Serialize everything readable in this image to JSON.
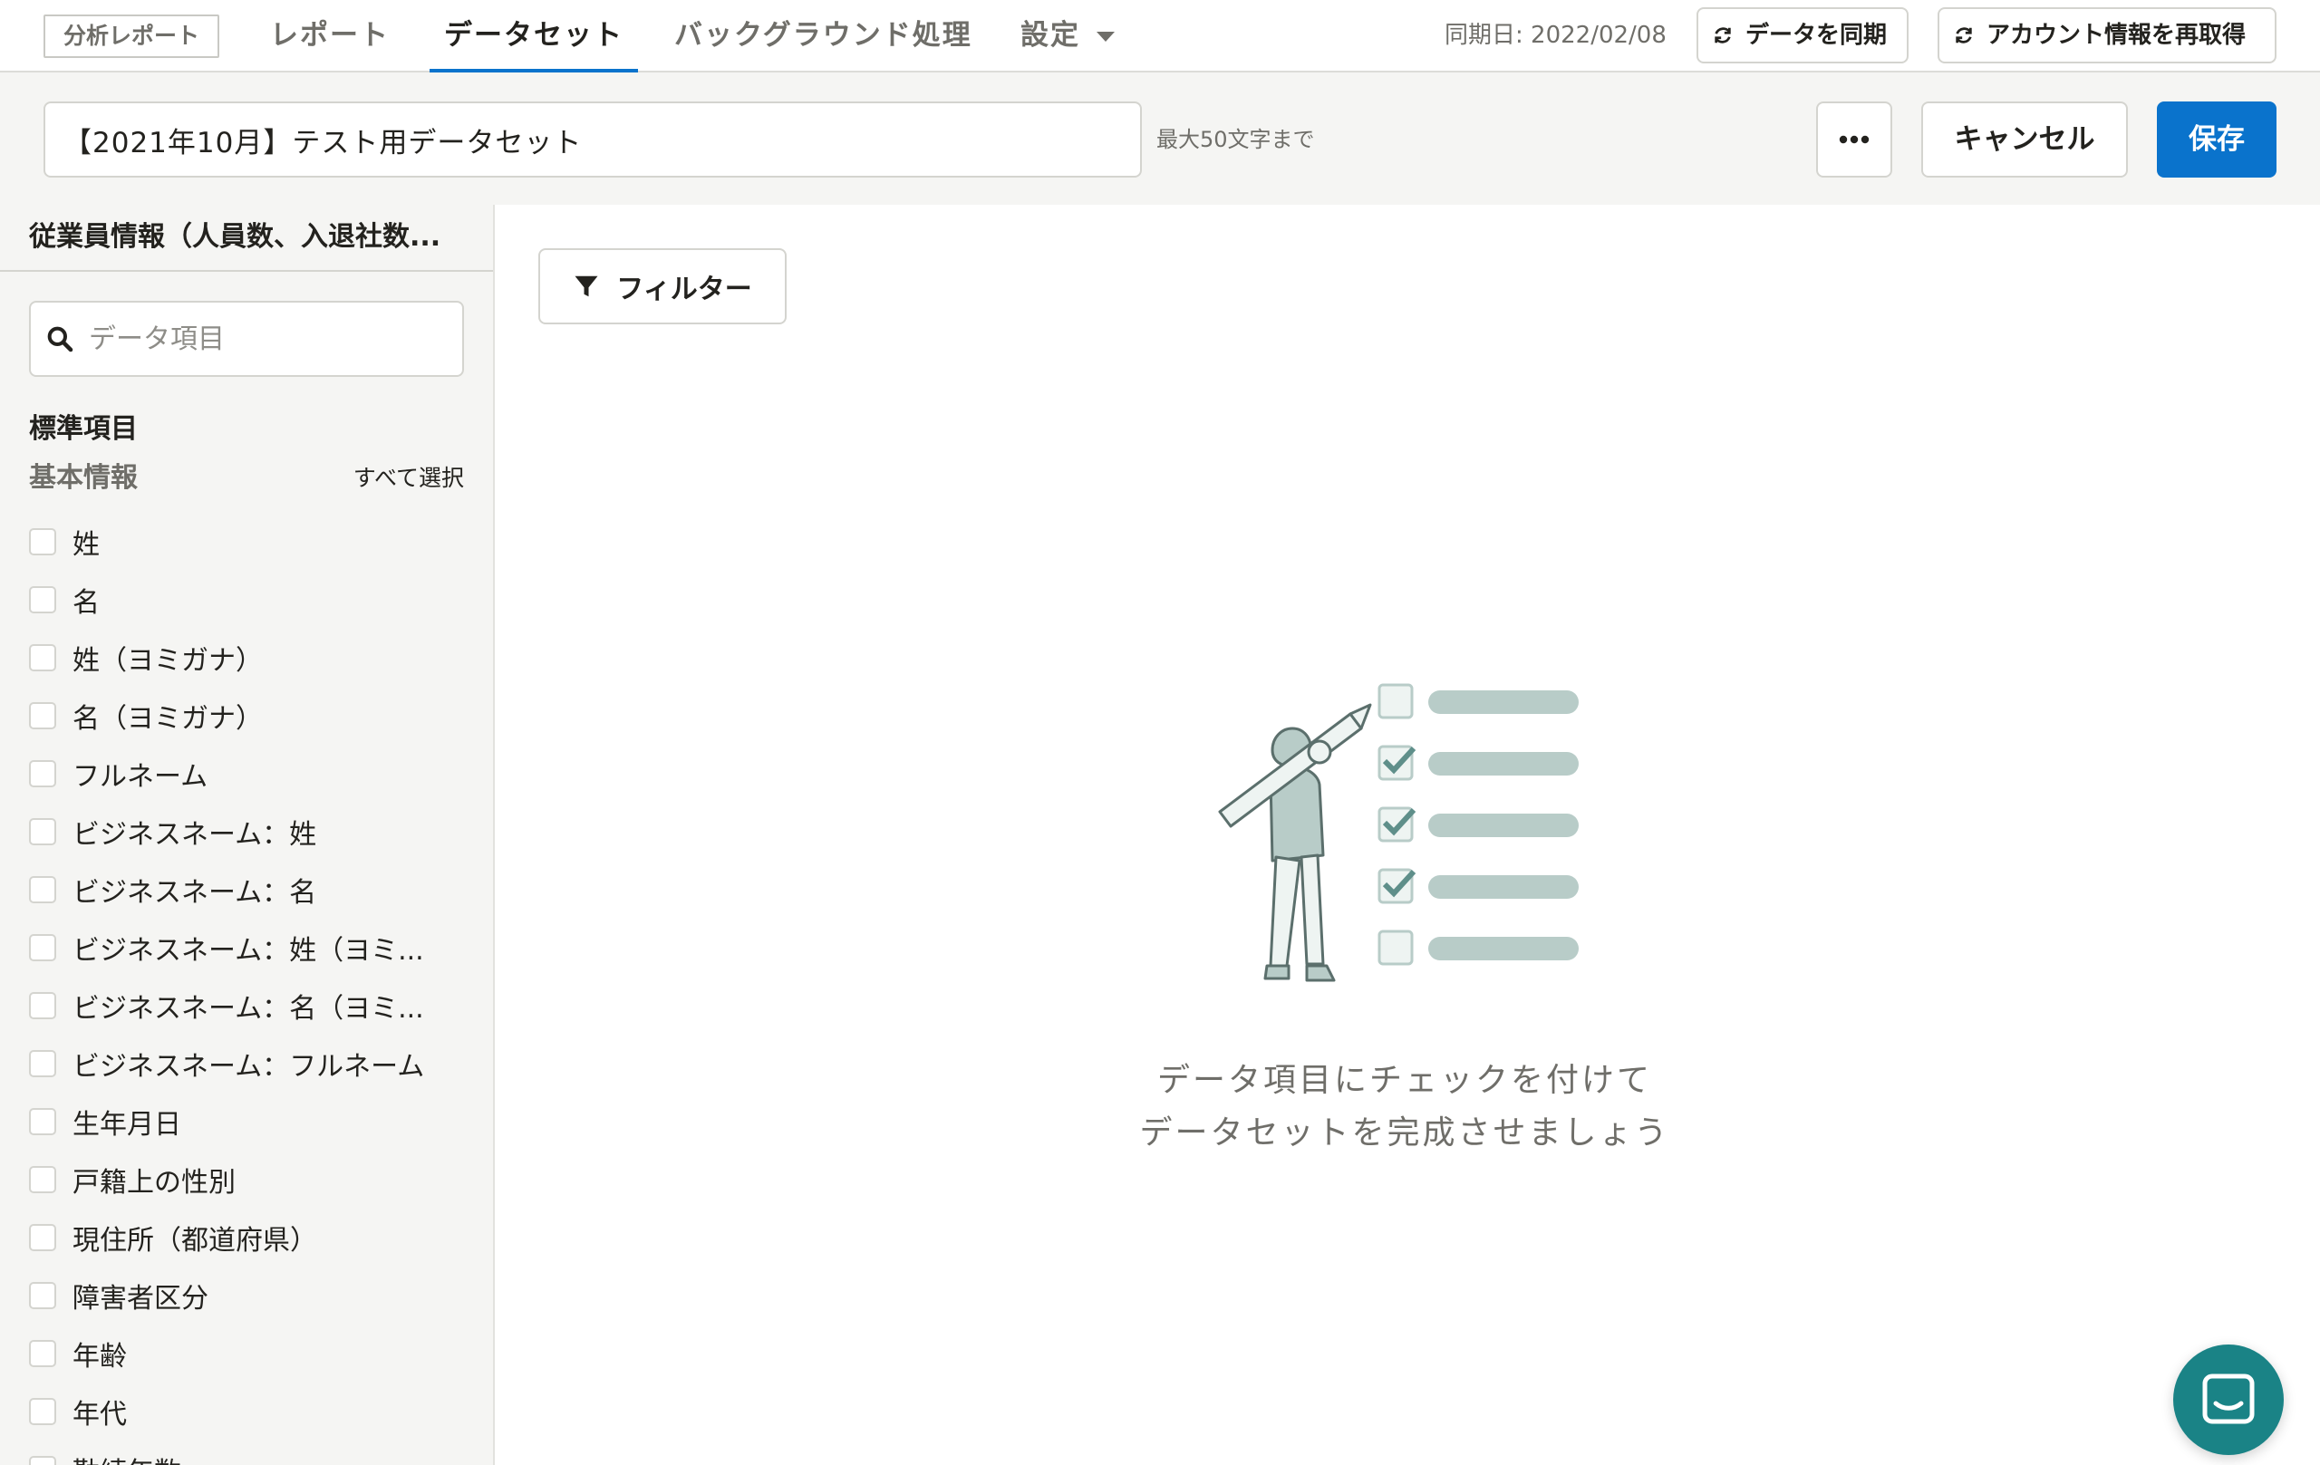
{
  "topnav": {
    "brand_tag": "分析レポート",
    "tabs": [
      {
        "label": "レポート"
      },
      {
        "label": "データセット"
      },
      {
        "label": "バックグラウンド処理"
      },
      {
        "label": "設定"
      }
    ],
    "active_tab": "データセット",
    "sync_date": "同期日: 2022/02/08",
    "sync_button": "データを同期",
    "reacquire_button": "アカウント情報を再取得"
  },
  "dataset": {
    "name": "【2021年10月】テスト用データセット",
    "char_limit": "最大50文字まで",
    "more_label": "•••",
    "cancel_label": "キャンセル",
    "save_label": "保存"
  },
  "sidebar": {
    "title": "従業員情報（人員数、入退社数...",
    "search_placeholder": "データ項目",
    "section_heading": "標準項目",
    "group_label": "基本情報",
    "select_all": "すべて選択",
    "fields": [
      {
        "label": "姓",
        "checked": false
      },
      {
        "label": "名",
        "checked": false
      },
      {
        "label": "姓（ヨミガナ）",
        "checked": false
      },
      {
        "label": "名（ヨミガナ）",
        "checked": false
      },
      {
        "label": "フルネーム",
        "checked": false
      },
      {
        "label": "ビジネスネーム：姓",
        "checked": false
      },
      {
        "label": "ビジネスネーム：名",
        "checked": false
      },
      {
        "label": "ビジネスネーム：姓（ヨミ...",
        "checked": false
      },
      {
        "label": "ビジネスネーム：名（ヨミ...",
        "checked": false
      },
      {
        "label": "ビジネスネーム：フルネーム",
        "checked": false
      },
      {
        "label": "生年月日",
        "checked": false
      },
      {
        "label": "戸籍上の性別",
        "checked": false
      },
      {
        "label": "現住所（都道府県）",
        "checked": false
      },
      {
        "label": "障害者区分",
        "checked": false
      },
      {
        "label": "年齢",
        "checked": false
      },
      {
        "label": "年代",
        "checked": false
      },
      {
        "label": "勤続年数",
        "checked": false
      }
    ]
  },
  "main": {
    "filter_label": "フィルター",
    "empty_line1": "データ項目にチェックを付けて",
    "empty_line2": "データセットを完成させましょう"
  },
  "colors": {
    "accent": "#0a73cc",
    "sidebar_bg": "#f5f5f3",
    "chat_button": "#1a8386",
    "illustration": "#b8ccc8"
  },
  "icons": [
    "refresh-icon",
    "ellipsis-icon",
    "search-icon",
    "filter-icon",
    "chat-icon",
    "caret-down-icon"
  ]
}
